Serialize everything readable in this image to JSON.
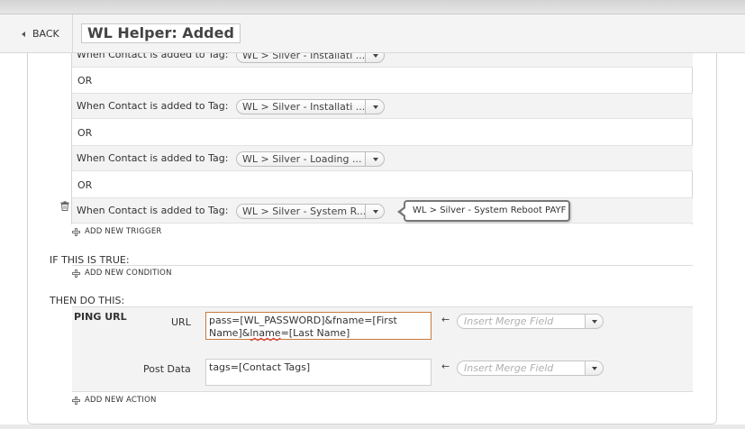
{
  "header": {
    "back_label": "BACK",
    "title": "WL Helper: Added"
  },
  "triggers": {
    "rows": [
      {
        "label": "When Contact is added to Tag:",
        "tag": "WL > Silver - Installati ..."
      },
      {
        "label": "When Contact is added to Tag:",
        "tag": "WL > Silver - Installati ..."
      },
      {
        "label": "When Contact is added to Tag:",
        "tag": "WL > Silver - Loading ..."
      },
      {
        "label": "When Contact is added to Tag:",
        "tag": "WL > Silver - System R..."
      }
    ],
    "or_label": "OR",
    "tooltip": "WL > Silver - System Reboot PAYF",
    "add_trigger": "ADD NEW TRIGGER"
  },
  "conditions": {
    "heading": "IF THIS IS TRUE:",
    "add_condition": "ADD NEW CONDITION"
  },
  "actions": {
    "heading": "THEN DO THIS:",
    "action_name": "PING URL",
    "url_label": "URL",
    "url_value_part1": "pass=[WL_PASSWORD]&fname=[First Name]&",
    "url_value_squiggle": "lname",
    "url_value_part2": "=[Last Name]",
    "post_label": "Post Data",
    "post_value": "tags=[Contact Tags]",
    "merge_placeholder": "Insert Merge Field",
    "add_action": "ADD NEW ACTION"
  }
}
